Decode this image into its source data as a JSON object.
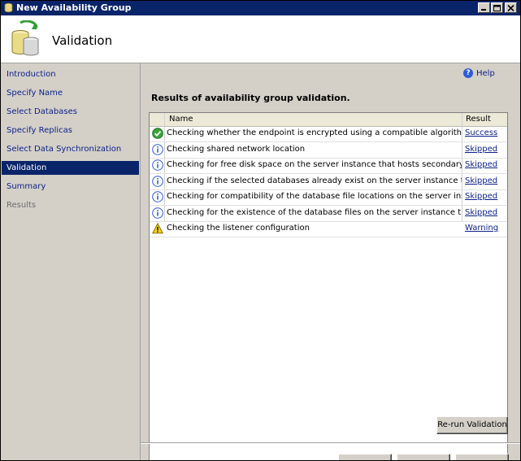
{
  "window": {
    "title": "New Availability Group"
  },
  "header": {
    "title": "Validation"
  },
  "nav": {
    "items": [
      {
        "label": "Introduction",
        "state": "link"
      },
      {
        "label": "Specify Name",
        "state": "link"
      },
      {
        "label": "Select Databases",
        "state": "link"
      },
      {
        "label": "Specify Replicas",
        "state": "link"
      },
      {
        "label": "Select Data Synchronization",
        "state": "link"
      },
      {
        "label": "Validation",
        "state": "selected"
      },
      {
        "label": "Summary",
        "state": "link"
      },
      {
        "label": "Results",
        "state": "disabled"
      }
    ]
  },
  "main": {
    "help_label": "Help",
    "results_heading": "Results of availability group validation.",
    "grid": {
      "columns": {
        "name": "Name",
        "result": "Result"
      },
      "rows": [
        {
          "icon": "success-icon",
          "name": "Checking whether the endpoint is encrypted using a compatible algorithm",
          "result": "Success"
        },
        {
          "icon": "info-icon",
          "name": "Checking shared network location",
          "result": "Skipped"
        },
        {
          "icon": "info-icon",
          "name": "Checking for free disk space on the server instance that hosts secondary replica ...",
          "result": "Skipped"
        },
        {
          "icon": "info-icon",
          "name": "Checking if the selected databases already exist on the server instance that host...",
          "result": "Skipped"
        },
        {
          "icon": "info-icon",
          "name": "Checking for compatibility of the database file locations on the server instance th...",
          "result": "Skipped"
        },
        {
          "icon": "info-icon",
          "name": "Checking for the existence of the database files on the server instance that host...",
          "result": "Skipped"
        },
        {
          "icon": "warning-icon",
          "name": "Checking the listener configuration",
          "result": "Warning"
        }
      ]
    },
    "rerun_label": "Re-run Validation"
  },
  "colors": {
    "titlebar": "#0a246a",
    "selected_nav": "#0a246a",
    "link": "#0b1f8a"
  }
}
